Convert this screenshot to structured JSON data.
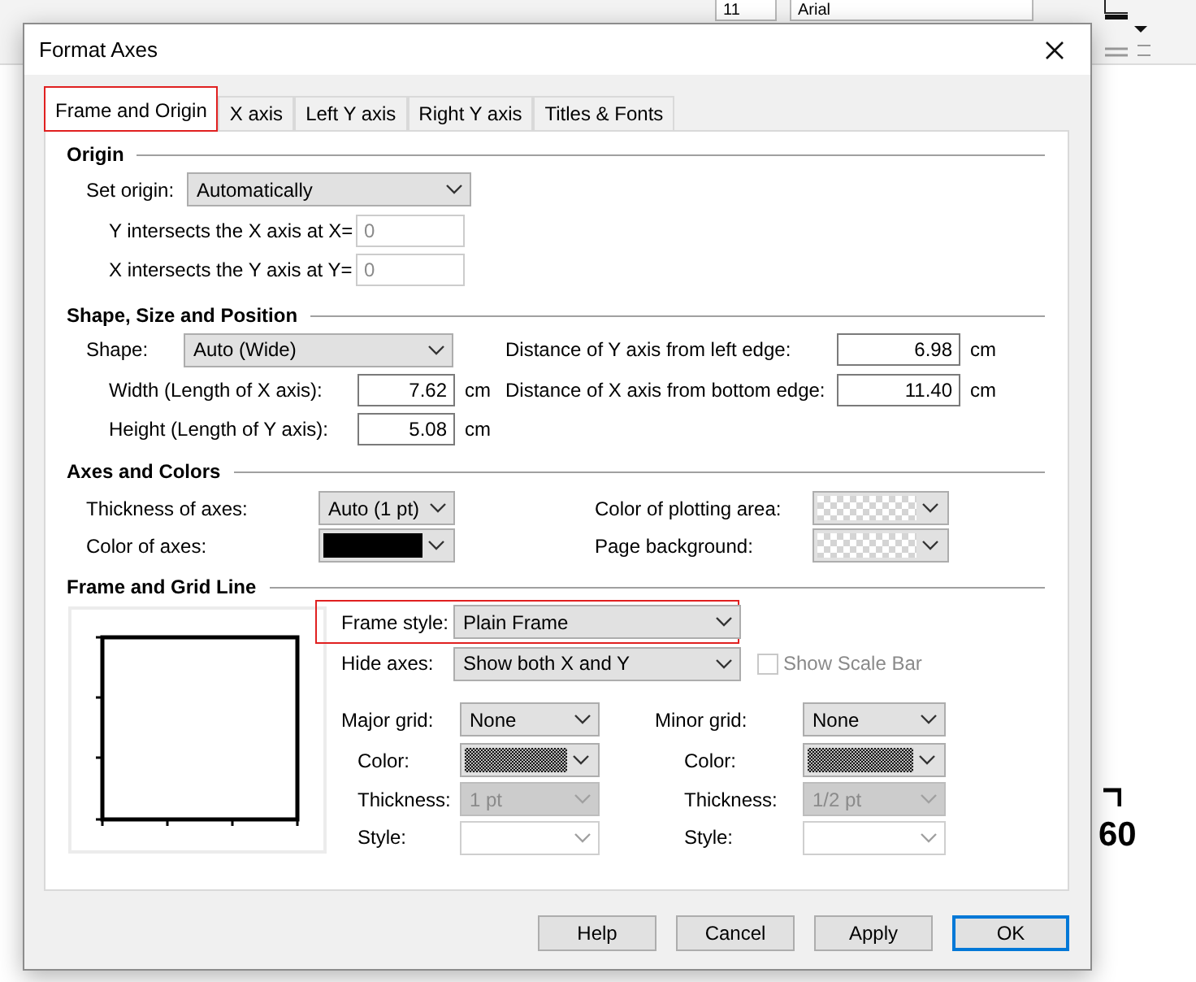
{
  "background": {
    "font_size": "11",
    "font_name": "Arial",
    "page_number": "60"
  },
  "dialog": {
    "title": "Format Axes"
  },
  "tabs": [
    {
      "label": "Frame and Origin",
      "selected": true,
      "highlighted": true
    },
    {
      "label": "X axis",
      "selected": false,
      "highlighted": false
    },
    {
      "label": "Left Y axis",
      "selected": false,
      "highlighted": false
    },
    {
      "label": "Right Y axis",
      "selected": false,
      "highlighted": false
    },
    {
      "label": "Titles & Fonts",
      "selected": false,
      "highlighted": false
    }
  ],
  "origin": {
    "title": "Origin",
    "set_origin": {
      "label": "Set origin:",
      "value": "Automatically"
    },
    "fields": [
      {
        "label": "Y intersects the X axis at X=",
        "value": "0",
        "disabled": true
      },
      {
        "label": "X intersects the Y axis at Y=",
        "value": "0",
        "disabled": true
      }
    ]
  },
  "shape": {
    "title": "Shape, Size and Position",
    "shape": {
      "label": "Shape:",
      "value": "Auto (Wide)"
    },
    "left_fields": [
      {
        "label": "Width (Length of X axis):",
        "value": "7.62",
        "unit": "cm"
      },
      {
        "label": "Height (Length of Y axis):",
        "value": "5.08",
        "unit": "cm"
      }
    ],
    "right_fields": [
      {
        "label": "Distance of Y axis from left edge:",
        "value": "6.98",
        "unit": "cm"
      },
      {
        "label": "Distance of X axis from bottom edge:",
        "value": "11.40",
        "unit": "cm"
      }
    ]
  },
  "axes_colors": {
    "title": "Axes and Colors",
    "thickness": {
      "label": "Thickness of axes:",
      "value": "Auto (1 pt)"
    },
    "color": {
      "label": "Color of axes:",
      "kind": "solid",
      "color": "#000000"
    },
    "plotting_area": {
      "label": "Color of plotting area:",
      "kind": "checker"
    },
    "page_background": {
      "label": "Page background:",
      "kind": "checker"
    }
  },
  "frame_grid": {
    "title": "Frame and Grid Line",
    "frame_style": {
      "label": "Frame style:",
      "value": "Plain Frame",
      "highlighted": true
    },
    "hide_axes": {
      "label": "Hide axes:",
      "value": "Show both X and Y"
    },
    "show_scale_bar": {
      "label": "Show Scale Bar",
      "checked": false,
      "disabled": true
    },
    "grids": [
      {
        "label": "Major grid:",
        "value": "None",
        "color_label": "Color:",
        "kind": "dither",
        "thickness_label": "Thickness:",
        "thickness": {
          "value": "1 pt",
          "disabled": true
        },
        "style_label": "Style:"
      },
      {
        "label": "Minor grid:",
        "value": "None",
        "color_label": "Color:",
        "kind": "dither",
        "thickness_label": "Thickness:",
        "thickness": {
          "value": "1/2 pt",
          "disabled": true
        },
        "style_label": "Style:"
      }
    ]
  },
  "buttons": [
    {
      "label": "Help",
      "default": false
    },
    {
      "label": "Cancel",
      "default": false
    },
    {
      "label": "Apply",
      "default": false
    },
    {
      "label": "OK",
      "default": true
    }
  ]
}
